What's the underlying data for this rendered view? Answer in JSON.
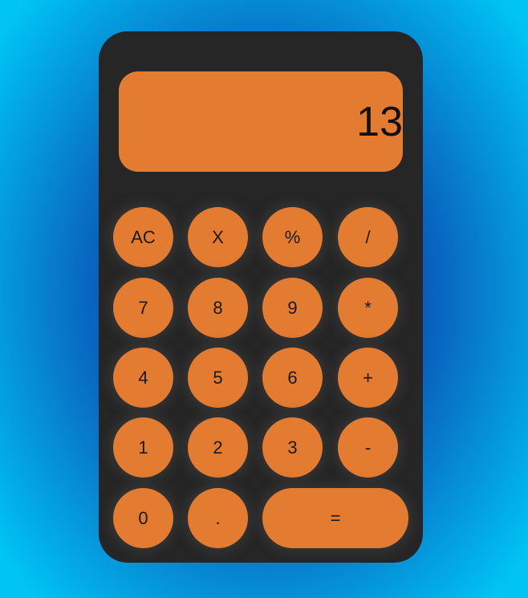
{
  "display": {
    "value": "13"
  },
  "keys": {
    "ac": "AC",
    "x": "X",
    "percent": "%",
    "divide": "/",
    "seven": "7",
    "eight": "8",
    "nine": "9",
    "multiply": "*",
    "four": "4",
    "five": "5",
    "six": "6",
    "plus": "+",
    "one": "1",
    "two": "2",
    "three": "3",
    "minus": "-",
    "zero": "0",
    "dot": ".",
    "equals": "="
  },
  "colors": {
    "body": "#262626",
    "accent": "#e37b31",
    "text": "#1a1a1a"
  }
}
